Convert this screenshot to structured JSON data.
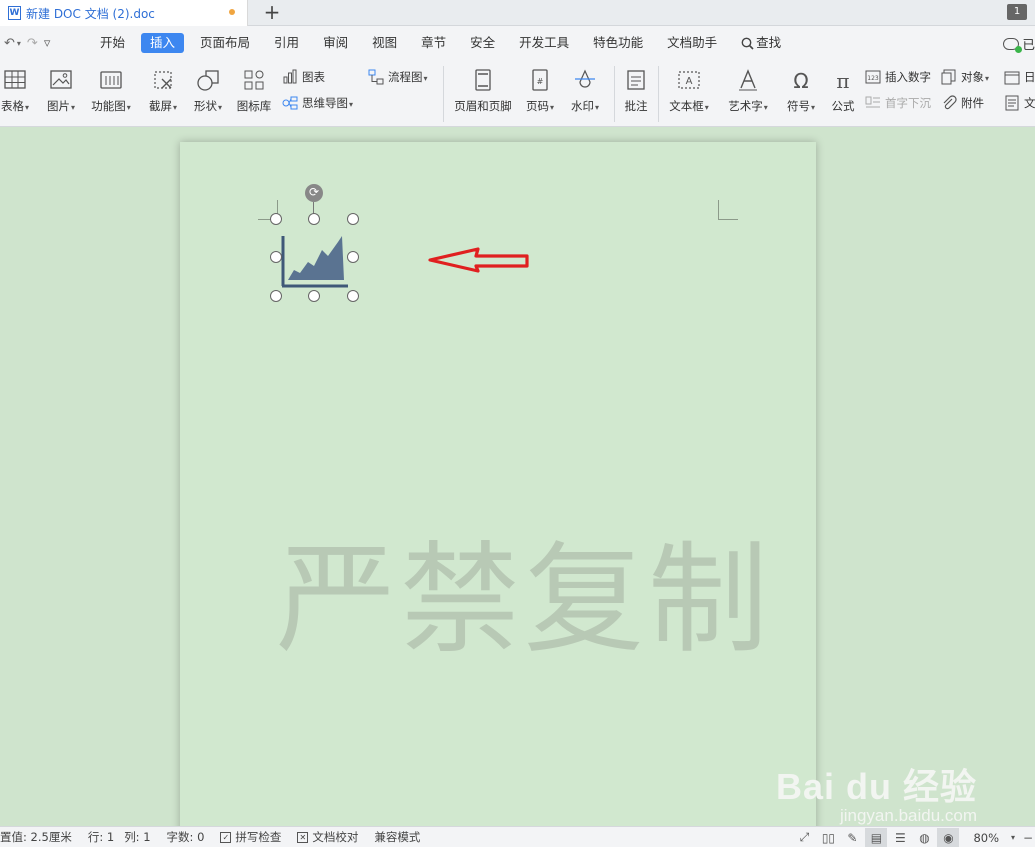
{
  "titlebar": {
    "doc_icon_letter": "W",
    "doc_title": "新建 DOC 文档 (2).doc",
    "new_tab": "+",
    "window_count": "1"
  },
  "quick_access": {
    "undo": "↶",
    "undo_caret": "▾",
    "redo": "↷",
    "more": "▿"
  },
  "menu": {
    "items": [
      "开始",
      "插入",
      "页面布局",
      "引用",
      "审阅",
      "视图",
      "章节",
      "安全",
      "开发工具",
      "特色功能",
      "文档助手"
    ],
    "active_index": 1,
    "search_label": "查找",
    "right_label": "已"
  },
  "ribbon": {
    "table": "表格",
    "picture": "图片",
    "function_chart": "功能图",
    "screenshot": "截屏",
    "shape": "形状",
    "icon_lib": "图标库",
    "chart": "图表",
    "mind_map": "思维导图",
    "flowchart": "流程图",
    "header_footer": "页眉和页脚",
    "page_num": "页码",
    "watermark": "水印",
    "comment": "批注",
    "textbox": "文本框",
    "wordart": "艺术字",
    "symbol": "符号",
    "formula": "公式",
    "insert_number": "插入数字",
    "drop_cap": "首字下沉",
    "object": "对象",
    "attachment": "附件",
    "date_cut": "日",
    "doc_cut": "文"
  },
  "document": {
    "watermark_text": "严禁复制",
    "brand_big": "Bai du 经验",
    "brand_small": "jingyan.baidu.com",
    "chart_color": "#5a7391",
    "arrow_color": "#e02020"
  },
  "status": {
    "position": "置值: 2.5厘米",
    "row": "行: 1",
    "col": "列: 1",
    "word_count": "字数: 0",
    "spell_check": "拼写检查",
    "doc_proof": "文档校对",
    "compat_mode": "兼容模式",
    "zoom": "80%"
  }
}
